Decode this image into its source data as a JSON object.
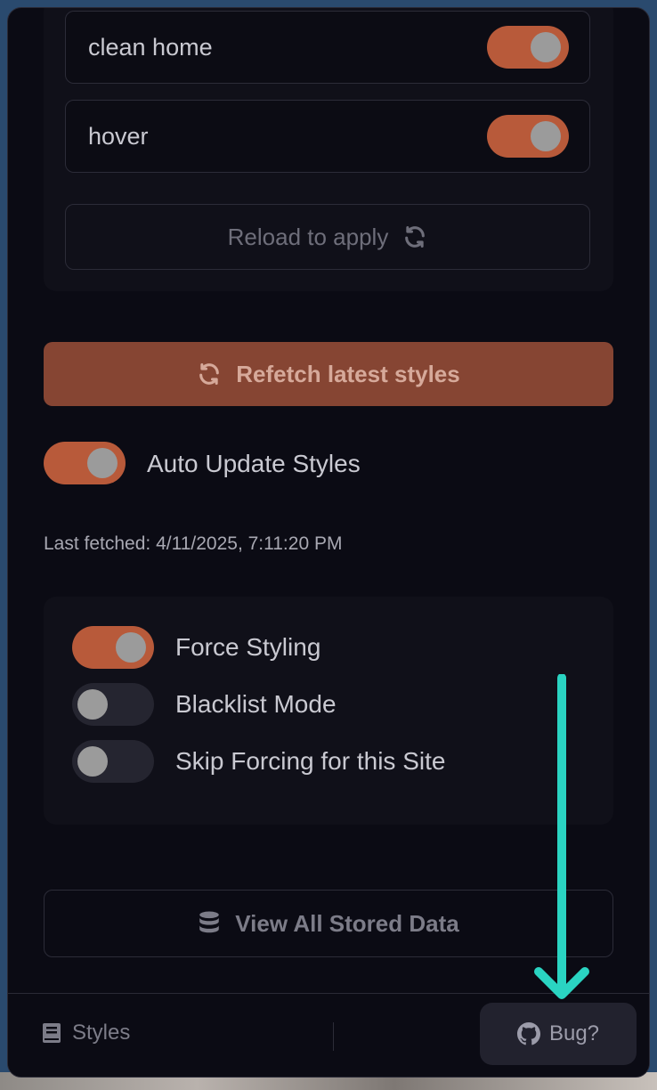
{
  "features": [
    {
      "label": "clean home",
      "enabled": true
    },
    {
      "label": "hover",
      "enabled": true
    }
  ],
  "reload_button": {
    "label": "Reload to apply",
    "icon": "sync-icon"
  },
  "refetch_button": {
    "label": "Refetch latest styles",
    "icon": "sync-icon"
  },
  "auto_update": {
    "label": "Auto Update Styles",
    "enabled": true
  },
  "last_fetched": "Last fetched: 4/11/2025, 7:11:20 PM",
  "force_options": [
    {
      "label": "Force Styling",
      "enabled": true
    },
    {
      "label": "Blacklist Mode",
      "enabled": false
    },
    {
      "label": "Skip Forcing for this Site",
      "enabled": false
    }
  ],
  "view_data_button": {
    "label": "View All Stored Data",
    "icon": "database-icon"
  },
  "footer": {
    "styles_label": "Styles",
    "styles_icon": "book-icon",
    "bug_label": "Bug?",
    "bug_icon": "github-icon"
  },
  "colors": {
    "accent": "#b85a3a",
    "annotation_arrow": "#2ad4c2",
    "panel_bg": "#0b0b14"
  }
}
